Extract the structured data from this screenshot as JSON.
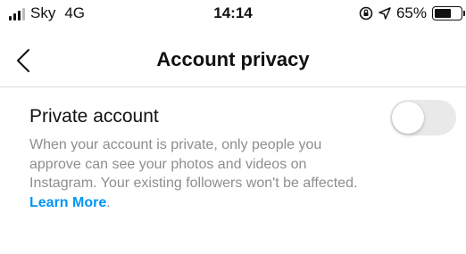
{
  "status_bar": {
    "carrier": "Sky",
    "network": "4G",
    "time": "14:14",
    "battery": "65%",
    "battery_level": 0.65
  },
  "nav": {
    "title": "Account privacy"
  },
  "private_account": {
    "title": "Private account",
    "description": "When your account is private, only people you approve can see your photos and videos on Instagram. Your existing followers won't be affected. ",
    "link": "Learn More",
    "period": ".",
    "enabled": false
  },
  "colors": {
    "link": "#0095f6",
    "toggle_off": "#e9e9ea",
    "desc_text": "#8e8e8e"
  },
  "icons": {
    "signal": "signal-bars-icon",
    "lock_rotation": "rotation-lock-icon",
    "location": "location-arrow-icon",
    "battery": "battery-icon",
    "back": "chevron-left-icon"
  }
}
